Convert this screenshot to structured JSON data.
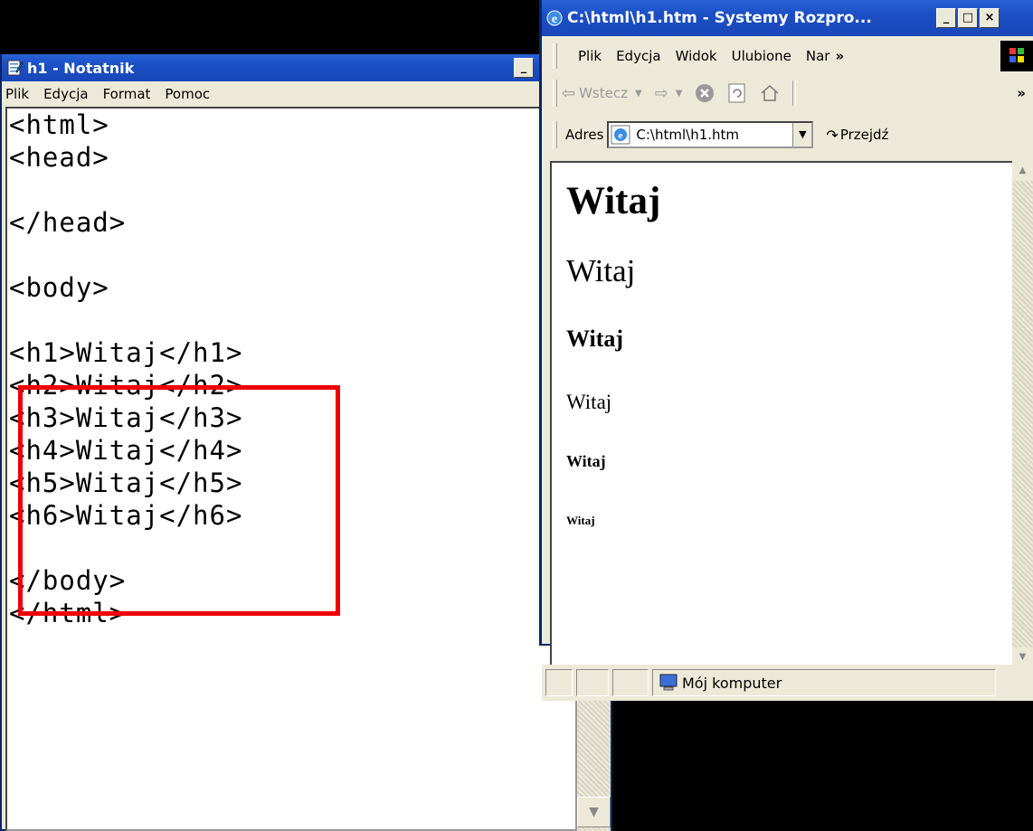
{
  "notepad": {
    "title": "h1 - Notatnik",
    "menu": [
      "Plik",
      "Edycja",
      "Format",
      "Pomoc"
    ],
    "lines": [
      "<html>",
      "<head>",
      "",
      "</head>",
      "",
      "<body>",
      "",
      "<h1>Witaj</h1>",
      "<h2>Witaj</h2>",
      "<h3>Witaj</h3>",
      "<h4>Witaj</h4>",
      "<h5>Witaj</h5>",
      "<h6>Witaj</h6>",
      "",
      "</body>",
      "</html>"
    ],
    "highlight_color": "#e00000"
  },
  "browser": {
    "title": "C:\\html\\h1.htm - Systemy Rozpro...",
    "menu": [
      "Plik",
      "Edycja",
      "Widok",
      "Ulubione",
      "Nar"
    ],
    "menu_overflow": "»",
    "toolbar": {
      "back_label": "Wstecz",
      "overflow": "»"
    },
    "address": {
      "label": "Adres",
      "value": "C:\\html\\h1.htm",
      "go_label": "Przejdź"
    },
    "content_headings": [
      "Witaj",
      "Witaj",
      "Witaj",
      "Witaj",
      "Witaj",
      "Witaj"
    ],
    "status": {
      "zone": "Mój komputer"
    }
  },
  "colors": {
    "titlebar": "#1b4fc4",
    "chrome": "#ece9d8",
    "desktop": "#000000"
  }
}
